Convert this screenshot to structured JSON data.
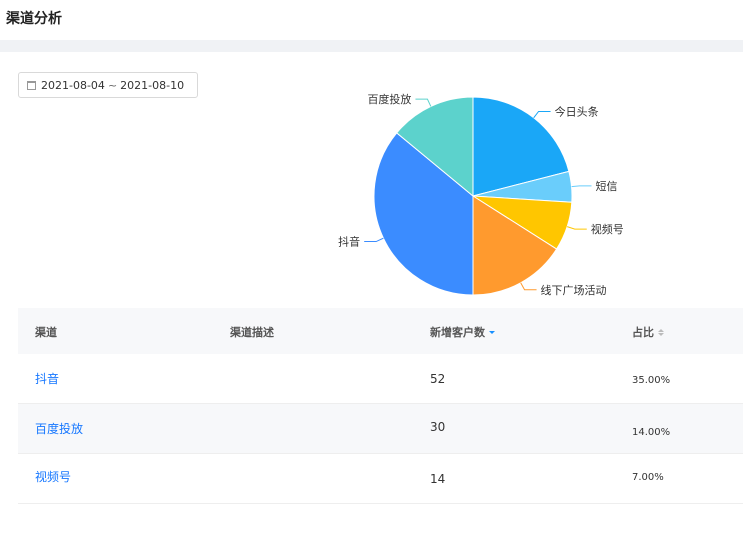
{
  "page": {
    "title": "渠道分析"
  },
  "filter": {
    "start_date": "2021-08-04",
    "separator": "~",
    "end_date": "2021-08-10"
  },
  "chart_data": {
    "type": "pie",
    "title": "",
    "slices": [
      {
        "label": "今日头条",
        "value": 21,
        "color": "#1aa7f7"
      },
      {
        "label": "短信",
        "value": 5,
        "color": "#6acdfb"
      },
      {
        "label": "视频号",
        "value": 8,
        "color": "#ffc600"
      },
      {
        "label": "线下广场活动",
        "value": 16,
        "color": "#ff9a2e"
      },
      {
        "label": "抖音",
        "value": 36,
        "color": "#3b8cff"
      },
      {
        "label": "百度投放",
        "value": 14,
        "color": "#5cd2cc"
      }
    ]
  },
  "table": {
    "headers": [
      "渠道",
      "渠道描述",
      "新增客户数",
      "占比"
    ],
    "rows": [
      {
        "channel": "抖音",
        "description": "",
        "new_customers": "52",
        "share": "35.00%"
      },
      {
        "channel": "百度投放",
        "description": "",
        "new_customers": "30",
        "share": "14.00%"
      },
      {
        "channel": "视频号",
        "description": "",
        "new_customers": "14",
        "share": "7.00%"
      }
    ]
  }
}
